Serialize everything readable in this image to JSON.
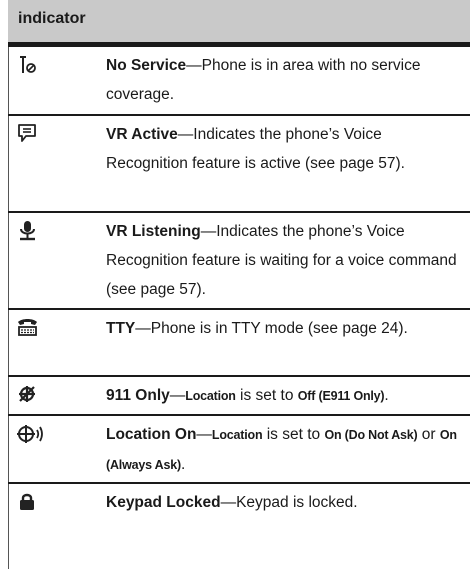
{
  "header": {
    "label": "indicator"
  },
  "rows": [
    {
      "icon": "no-service-icon",
      "title": "No Service",
      "desc": "—Phone is in area with no service coverage."
    },
    {
      "icon": "voice-recognition-active-icon",
      "title": "VR Active",
      "desc": "—Indicates the phone’s Voice Recognition feature is active (see page 57)."
    },
    {
      "icon": "microphone-icon",
      "title": "VR Listening",
      "desc": "—Indicates the phone’s Voice Recognition feature is waiting for a voice command (see page 57)."
    },
    {
      "icon": "tty-icon",
      "title": "TTY",
      "desc": "—Phone is in TTY mode (see page 24)."
    },
    {
      "icon": "location-off-icon",
      "title": "911 Only",
      "desc_parts": [
        "—",
        "Location",
        " is set to ",
        "Off (E911 Only)",
        "."
      ]
    },
    {
      "icon": "location-on-icon",
      "title": "Location On",
      "desc_parts": [
        "—",
        "Location",
        " is set to ",
        "On (Do Not Ask)",
        " or ",
        "On (Always Ask)",
        "."
      ]
    },
    {
      "icon": "lock-icon",
      "title": "Keypad Locked",
      "desc": "—Keypad is locked."
    }
  ]
}
